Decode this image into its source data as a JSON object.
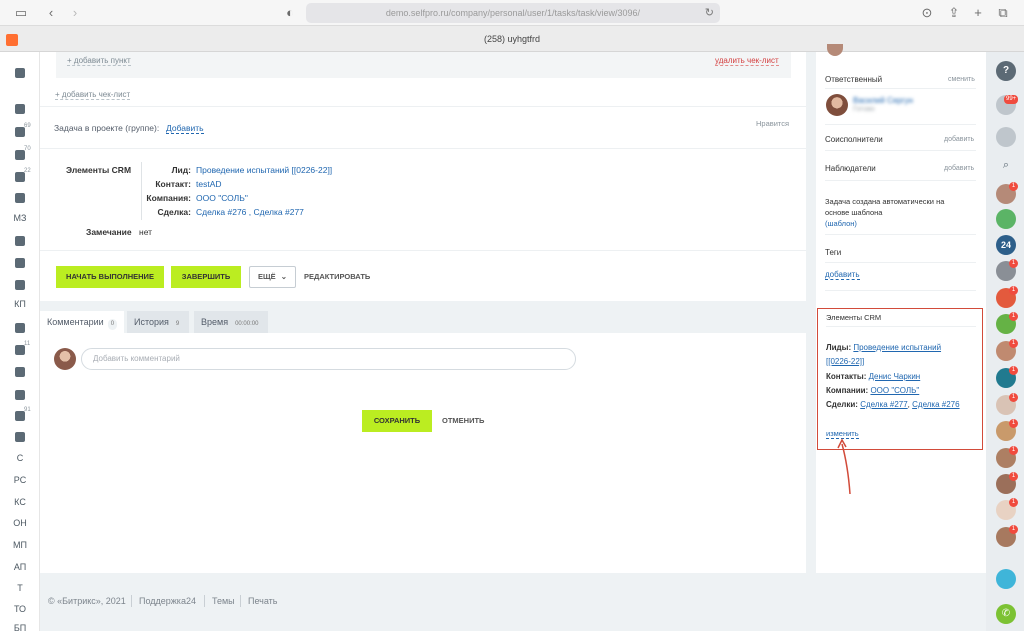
{
  "browser": {
    "url": "demo.selfpro.ru/company/personal/user/1/tasks/task/view/3096/",
    "tab_title": "(258) uyhgtfrd"
  },
  "left_menu": {
    "items": [
      {
        "label": "",
        "icon": "menu-icon"
      },
      {
        "label": "",
        "icon": "news-icon"
      },
      {
        "label": "",
        "icon": "filter-icon",
        "count": "69"
      },
      {
        "label": "",
        "icon": "tasks-icon",
        "count": "70"
      },
      {
        "label": "",
        "icon": "refresh-icon",
        "count": "22"
      },
      {
        "label": "",
        "icon": "clock-icon"
      },
      {
        "label": "МЗ"
      },
      {
        "label": "",
        "icon": "calendar-icon"
      },
      {
        "label": "",
        "icon": "building-icon"
      },
      {
        "label": "",
        "icon": "notes-icon"
      },
      {
        "label": "КП"
      },
      {
        "label": "",
        "icon": "drive-icon"
      },
      {
        "label": "",
        "icon": "chat-icon",
        "count": "11"
      },
      {
        "label": "",
        "icon": "group-icon"
      },
      {
        "label": "",
        "icon": "flow-icon"
      },
      {
        "label": "",
        "icon": "mail-icon",
        "count": "91"
      },
      {
        "label": "",
        "icon": "box-icon"
      },
      {
        "label": "С"
      },
      {
        "label": "РС"
      },
      {
        "label": "КС"
      },
      {
        "label": "ОН"
      },
      {
        "label": "МП"
      },
      {
        "label": "АП"
      },
      {
        "label": "Т"
      },
      {
        "label": "ТО"
      },
      {
        "label": "БП"
      }
    ]
  },
  "checklist": {
    "add_item": "+ добавить пункт",
    "delete_checklist": "удалить чек-лист",
    "add_checklist": "+ добавить чек-лист"
  },
  "project": {
    "label": "Задача в проекте (группе):",
    "add": "Добавить",
    "like": "Нравится"
  },
  "crm": {
    "title": "Элементы CRM",
    "lead_label": "Лид:",
    "lead_value": "Проведение испытаний [[0226-22]]",
    "contact_label": "Контакт:",
    "contact_value": "testAD",
    "company_label": "Компания:",
    "company_value": "ООО \"СОЛЬ\"",
    "deal_label": "Сделка:",
    "deal_value": "Сделка #276 , Сделка #277",
    "remark_label": "Замечание",
    "remark_value": "нет"
  },
  "actions": {
    "start": "НАЧАТЬ ВЫПОЛНЕНИЕ",
    "finish": "ЗАВЕРШИТЬ",
    "more": "ЕЩЁ",
    "edit": "РЕДАКТИРОВАТЬ"
  },
  "tabs": [
    {
      "label": "Комментарии",
      "badge": "0"
    },
    {
      "label": "История",
      "badge": "9"
    },
    {
      "label": "Время",
      "badge": "00:00:00"
    }
  ],
  "comment": {
    "placeholder": "Добавить комментарий",
    "save": "СОХРАНИТЬ",
    "cancel": "ОТМЕНИТЬ"
  },
  "footer": {
    "copyright": "© «Битрикс», 2021",
    "support": "Поддержка24",
    "themes": "Темы",
    "print": "Печать"
  },
  "sidebar": {
    "responsible_label": "Ответственный",
    "responsible_action": "сменить",
    "responsible_name": "Василий Сергун",
    "responsible_role": "Готово",
    "coexec_label": "Соисполнители",
    "coexec_action": "добавить",
    "observers_label": "Наблюдатели",
    "observers_action": "добавить",
    "auto_text_1": "Задача создана автоматически на",
    "auto_text_2": "основе шаблона",
    "auto_text_3": "(шаблон)",
    "tags_label": "Теги",
    "tags_action": "добавить",
    "crm_box": {
      "title": "Элементы CRM",
      "leads_label": "Лиды:",
      "leads_value_1": "Проведение испытаний",
      "leads_value_2": "[[0226-22]]",
      "contacts_label": "Контакты:",
      "contacts_value": "Денис Чаркин",
      "companies_label": "Компании:",
      "companies_value": "ООО \"СОЛЬ\"",
      "deals_label": "Сделки:",
      "deal_1": "Сделка #277",
      "deal_2": "Сделка #276",
      "change": "изменить"
    }
  },
  "right_rail": {
    "notifications_badge": "99+",
    "counter_label": "24"
  },
  "colors": {
    "accent_green": "#bbed21",
    "link_blue": "#2067b0",
    "highlight_red": "#d24b3a",
    "badge_red": "#f04b3e"
  }
}
